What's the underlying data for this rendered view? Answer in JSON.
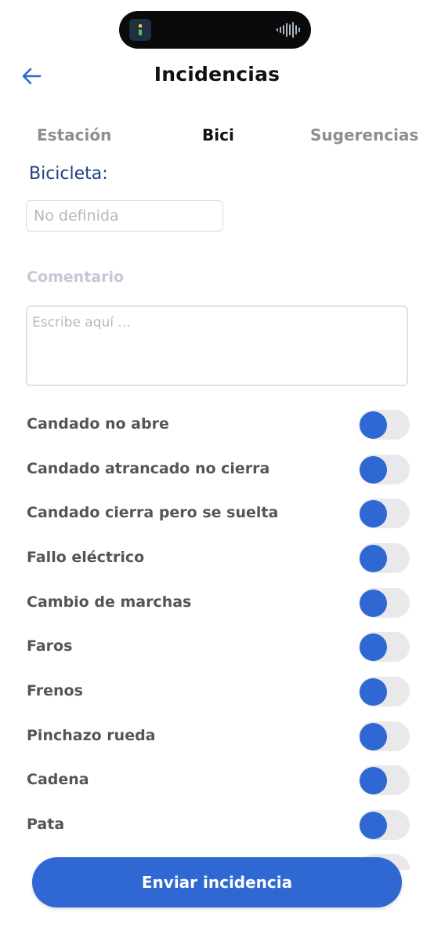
{
  "header": {
    "title": "Incidencias",
    "back_icon": "arrow-left-icon"
  },
  "tabs": [
    {
      "label": "Estación",
      "active": false
    },
    {
      "label": "Bici",
      "active": true
    },
    {
      "label": "Sugerencias",
      "active": false
    }
  ],
  "bike": {
    "label": "Bicicleta:",
    "value": "No definida"
  },
  "comment": {
    "label": "Comentario",
    "placeholder": "Escribe aquí ..."
  },
  "issues": [
    {
      "label": "Candado no abre",
      "on": false
    },
    {
      "label": "Candado atrancado no cierra",
      "on": false
    },
    {
      "label": "Candado cierra pero se suelta",
      "on": false
    },
    {
      "label": "Fallo eléctrico",
      "on": false
    },
    {
      "label": "Cambio de marchas",
      "on": false
    },
    {
      "label": "Faros",
      "on": false
    },
    {
      "label": "Frenos",
      "on": false
    },
    {
      "label": "Pinchazo rueda",
      "on": false
    },
    {
      "label": "Cadena",
      "on": false
    },
    {
      "label": "Pata",
      "on": false
    }
  ],
  "submit": {
    "label": "Enviar incidencia"
  },
  "colors": {
    "accent": "#2f67d3",
    "section_label": "#1d3f83",
    "toggle_track": "#e9e9ec"
  }
}
